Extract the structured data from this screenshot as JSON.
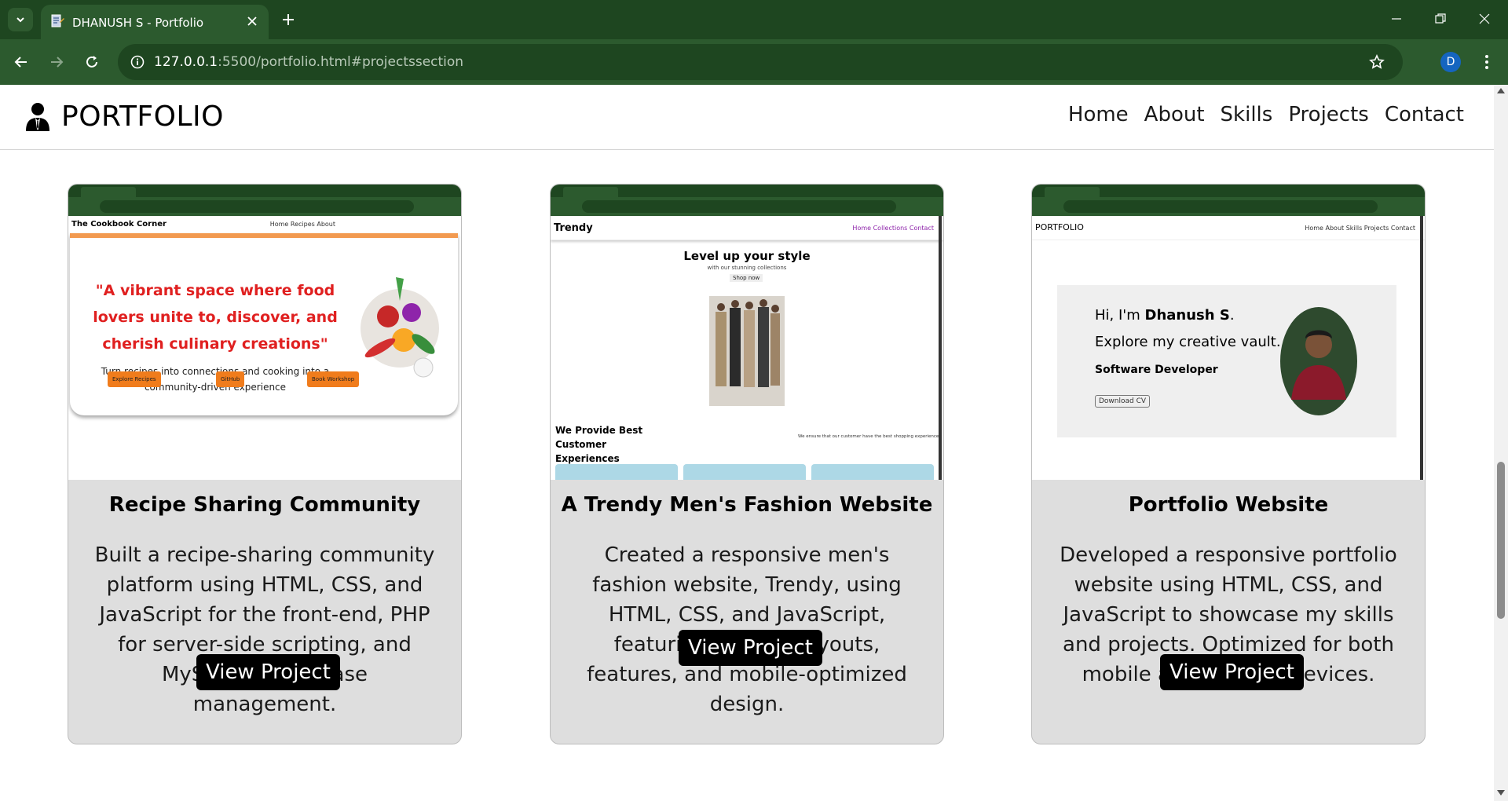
{
  "browser": {
    "tab_title": "DHANUSH S - Portfolio",
    "url_host": "127.0.0.1",
    "url_path": ":5500/portfolio.html#projectssection",
    "profile_initial": "D",
    "accent": "#1e4620"
  },
  "header": {
    "brand": "PORTFOLIO",
    "nav": [
      "Home",
      "About",
      "Skills",
      "Projects",
      "Contact"
    ]
  },
  "projects": [
    {
      "title": "Recipe Sharing Community",
      "description": "Built a recipe-sharing community platform using HTML, CSS, and JavaScript for the front-end, PHP for server-side scripting, and MySQL for database management.",
      "button": "View Project",
      "preview": {
        "site_title": "The Cookbook Corner",
        "nav": "Home  Recipes  About",
        "quote": "\"A vibrant space where food lovers unite to, discover, and cherish culinary creations\"",
        "tagline": "Turn recipes into connections and cooking into a community-driven experience",
        "buttons": [
          "Explore Recipes",
          "GitHub",
          "Book Workshop"
        ]
      }
    },
    {
      "title": "A Trendy Men's Fashion Website",
      "description": "Created a responsive men's fashion website, Trendy, using HTML, CSS, and JavaScript, featuring modern layouts, features, and mobile-optimized design.",
      "button": "View Project",
      "preview": {
        "site_title": "Trendy",
        "nav": "Home Collections Contact",
        "headline": "Level up your style",
        "sub": "with our stunning collections",
        "cta": "Shop now",
        "section": "We Provide Best Customer Experiences",
        "note": "We ensure that our customer have the best shopping experience"
      }
    },
    {
      "title": "Portfolio Website",
      "description": "Developed a responsive portfolio website using HTML, CSS, and JavaScript to showcase my skills and projects. Optimized for both mobile and desktop devices.",
      "button": "View Project",
      "preview": {
        "site_title": "PORTFOLIO",
        "nav": "Home  About  Skills  Projects  Contact",
        "greeting": "Hi, I'm",
        "name": "Dhanush S",
        "line2": "Explore my creative vault.",
        "role": "Software Developer",
        "cv": "Download CV"
      }
    }
  ]
}
